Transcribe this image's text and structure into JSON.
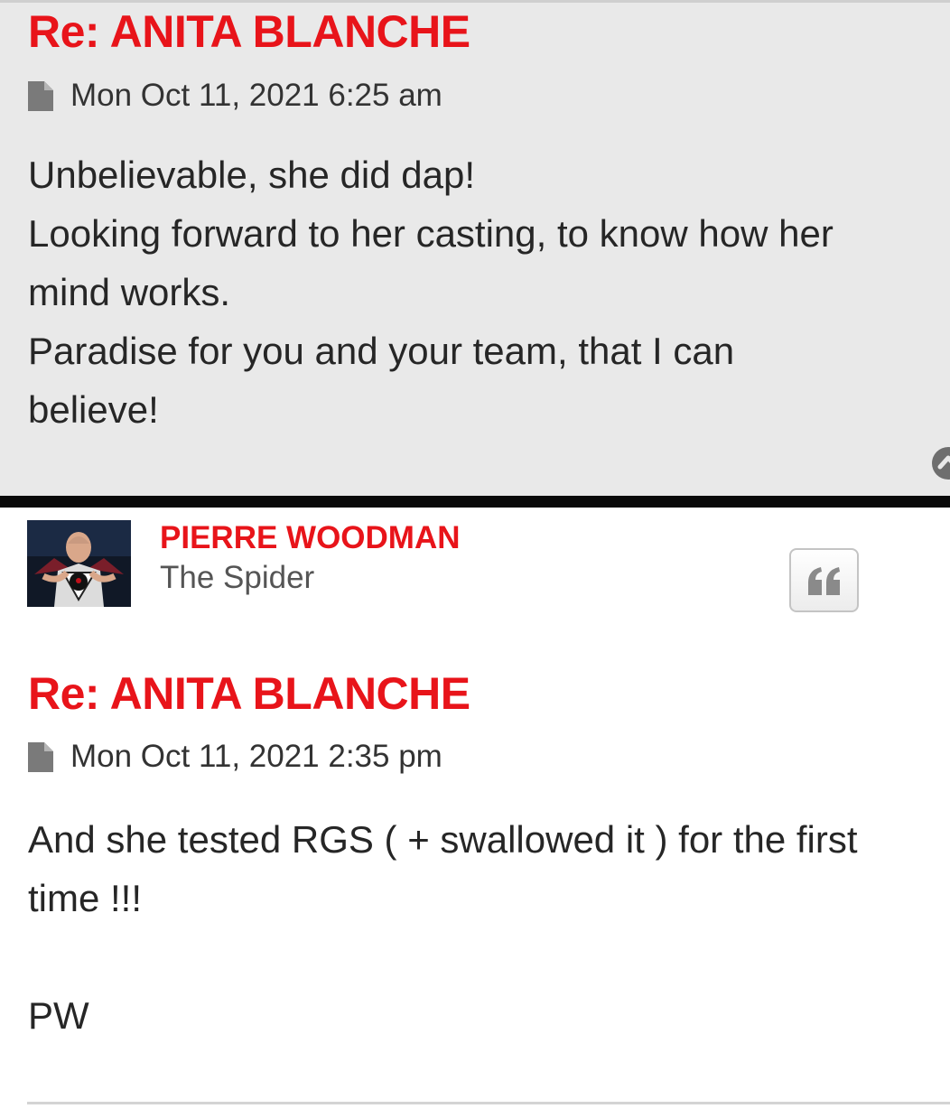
{
  "post1": {
    "title": "Re: ANITA BLANCHE",
    "date": "Mon Oct 11, 2021 6:25 am",
    "lines": [
      "Unbelievable, she did dap!",
      "Looking forward to her casting, to know how her",
      "mind works.",
      "Paradise for you and your team, that I can",
      "believe!"
    ]
  },
  "post2": {
    "author": {
      "name": "PIERRE WOODMAN",
      "rank": "The Spider"
    },
    "title": "Re: ANITA BLANCHE",
    "date": "Mon Oct 11, 2021 2:35 pm",
    "lines": [
      "And she tested RGS ( + swallowed it ) for the first",
      "time !!!",
      "",
      "PW"
    ]
  },
  "icons": {
    "post_icon": "file-icon",
    "back_to_top": "circle-up-icon",
    "quote": "quote-icon"
  },
  "colors": {
    "title_red": "#e8141a",
    "top_post_bg": "#e9e9e9",
    "divider": "#0a0a0a"
  }
}
